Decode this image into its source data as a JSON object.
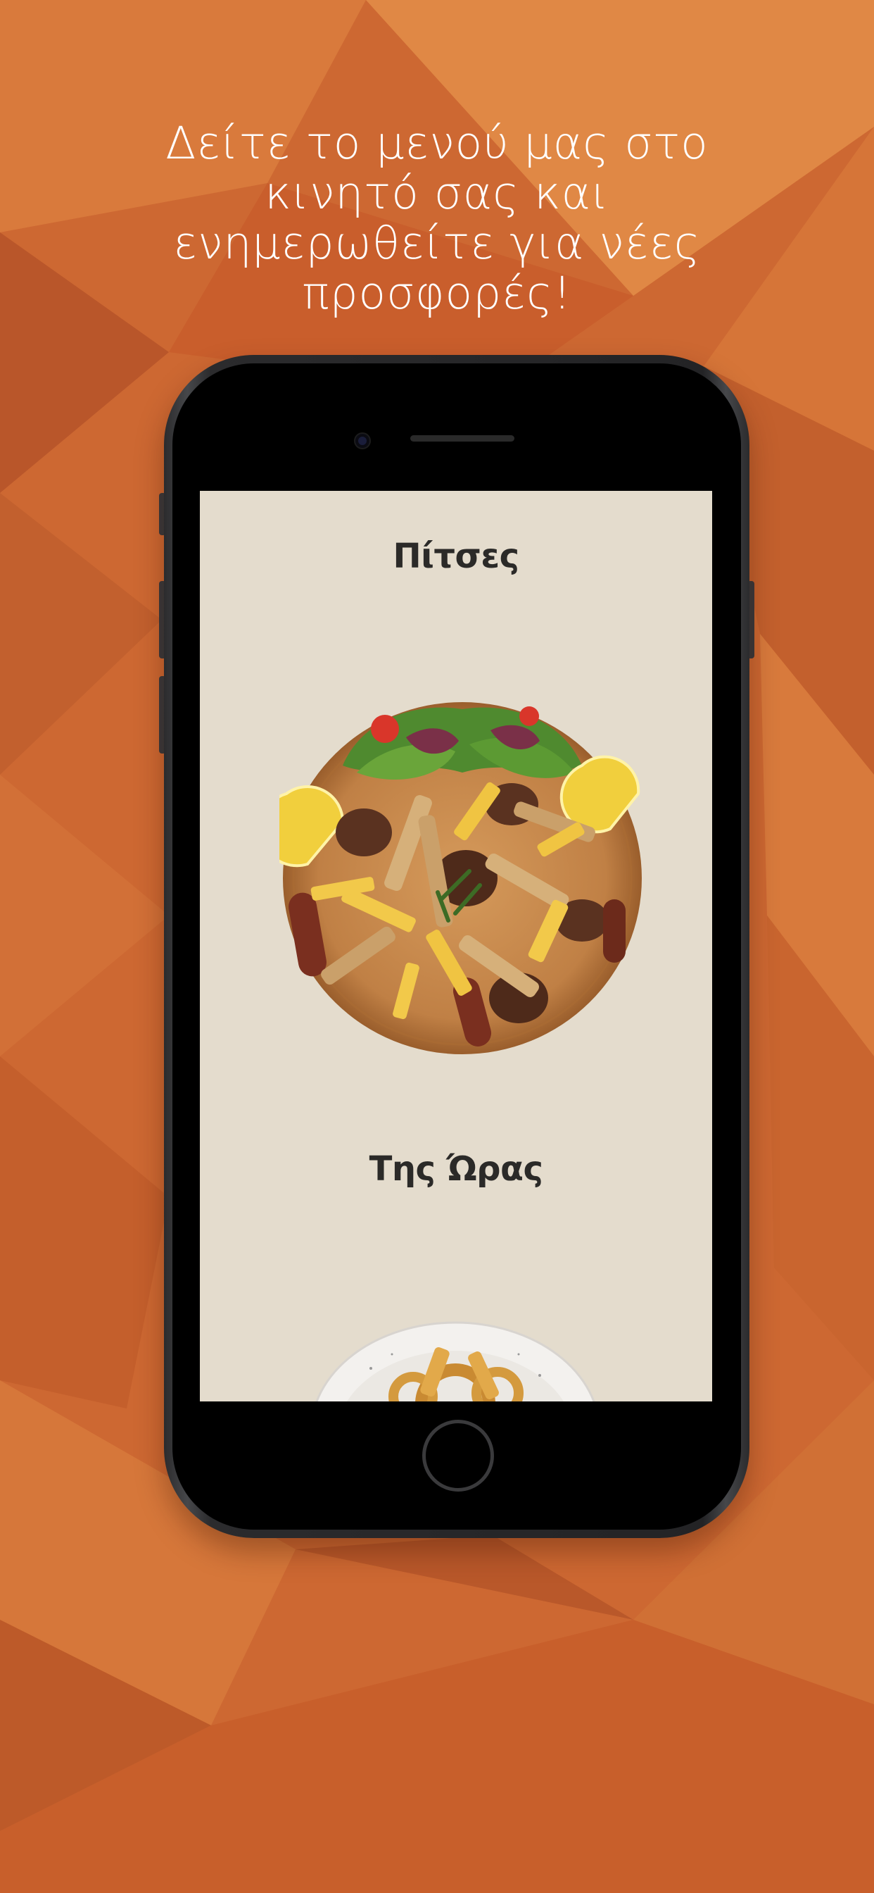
{
  "promo": {
    "headline_lines": [
      "Δείτε το μενού μας στο",
      "κινητό σας και",
      "ενημερωθείτε για νέες",
      "προσφορές!"
    ]
  },
  "menu": {
    "categories": [
      {
        "title": "Πίτσες",
        "image": "mixed-grill-platter"
      },
      {
        "title": "Της Ώρας",
        "image": "fried-calamari-bowl"
      }
    ]
  },
  "colors": {
    "background": "#cf6a33",
    "screen": "#e4dccd",
    "title_text": "#2b2a28",
    "headline_text": "#ffffff"
  }
}
